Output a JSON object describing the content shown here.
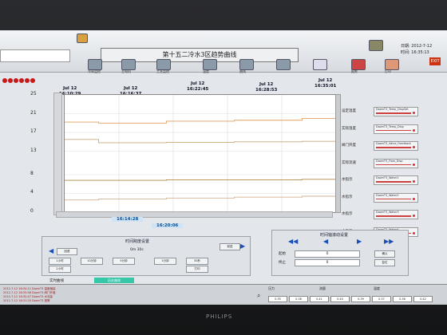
{
  "window": {
    "title": "第十五二冷水3区趋势曲线",
    "date_label": "日期:",
    "date_value": "2012-7-12",
    "time_label": "时间:",
    "time_value": "16:35:13",
    "exit_label": "EXIT",
    "monitor_brand": "PHILIPS"
  },
  "toolbar": {
    "items": [
      "主菜单",
      "冷床监控",
      "主电机",
      "工艺监控",
      "温度",
      "曲线",
      "报警",
      "打印"
    ]
  },
  "chart": {
    "time_headers": [
      {
        "date": "Jul 12",
        "time": "16:10:29"
      },
      {
        "date": "Jul 12",
        "time": "16:16:37"
      },
      {
        "date": "Jul 12",
        "time": "16:22:45"
      },
      {
        "date": "Jul 12",
        "time": "16:28:53"
      },
      {
        "date": "Jul 12",
        "time": "16:35:01"
      }
    ],
    "cursor_times": [
      "16:14:28",
      "16:20:06"
    ]
  },
  "chart_data": {
    "type": "line",
    "ylim": [
      0,
      25
    ],
    "yticks": [
      25,
      21,
      17,
      13,
      8,
      4,
      0
    ],
    "x": [
      "16:10:29",
      "16:16:37",
      "16:22:45",
      "16:28:53",
      "16:35:01"
    ],
    "series": [
      {
        "color": "#e0a060",
        "values": [
          19.2,
          19.0,
          19.4,
          19.6,
          20.0
        ]
      },
      {
        "color": "#c8a878",
        "values": [
          15.5,
          14.8,
          14.9,
          15.0,
          15.1
        ]
      },
      {
        "color": "#b08840",
        "values": [
          6.8,
          6.8,
          6.9,
          6.9,
          7.0
        ]
      },
      {
        "color": "#d4b090",
        "values": [
          2.6,
          2.8,
          3.0,
          3.2,
          3.4
        ]
      }
    ],
    "grid": true
  },
  "right_panel": {
    "items": [
      {
        "label": "设定温度",
        "field": "DownT3_Temp_DispSet"
      },
      {
        "label": "实际温度",
        "field": "DownT3_Temp_Disp"
      },
      {
        "label": "阀门开度",
        "field": "DownT3_Valve_Feedback"
      },
      {
        "label": "实际流速",
        "field": "DownT3_Flow_Disp"
      },
      {
        "label": "水指示",
        "field": "DownT3_Water1"
      },
      {
        "label": "水指示",
        "field": "DownT3_Water2"
      },
      {
        "label": "水指示",
        "field": "DownT3_Water3"
      },
      {
        "label": "水指示",
        "field": "DownT3_Water4"
      }
    ]
  },
  "controls": {
    "zoom_title": "时间跨度设置",
    "zoom_value": "0m 30s",
    "back_label": "回退",
    "forward_label": "前进",
    "zoom_buttons": [
      "1小时",
      "10分钟",
      "5分钟",
      "1分钟",
      "30秒",
      "2小时"
    ],
    "nav_title": "时间轴滚动设置",
    "start_label": "起始",
    "end_label": "终止",
    "start_value": "0",
    "end_value": "0",
    "apply_label": "确认",
    "reset_label": "复位",
    "print_label": "打印",
    "realtime_label": "实时曲线",
    "history_label": "历史曲线"
  },
  "status": {
    "logs": [
      "2012-7-12 16:34:11  DownT3 温度偏高",
      "2012-7-12 16:33:58  DownT3 阀门开度",
      "2012-7-12 16:32:47  DownT3 水流量",
      "2012-7-12 16:31:20  DownT3 报警"
    ],
    "pressure_label": "压力",
    "flow_label": "流量",
    "temp_label": "温度",
    "values": [
      "0.35",
      "0.38",
      "0.41",
      "0.40",
      "0.39",
      "0.37",
      "0.36",
      "0.42"
    ]
  }
}
